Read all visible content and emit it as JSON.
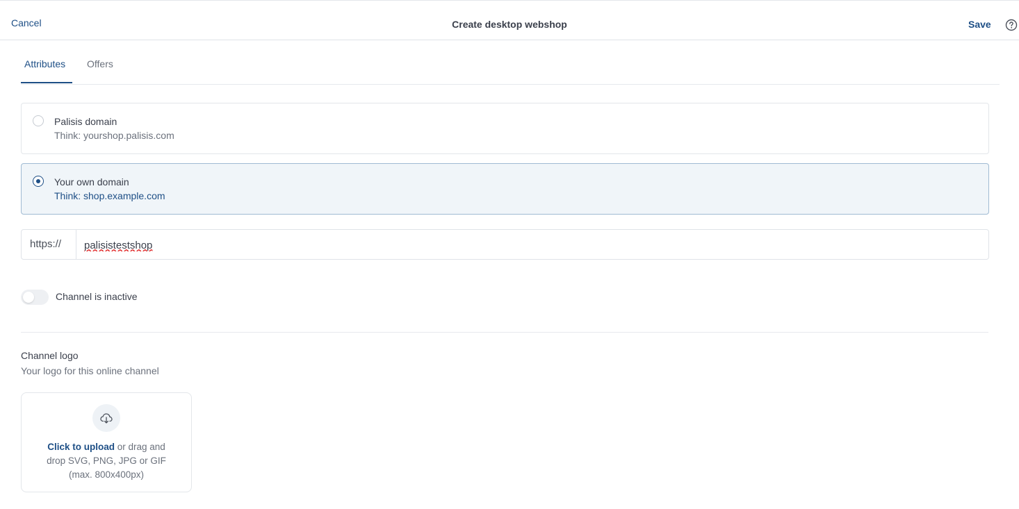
{
  "header": {
    "cancel_label": "Cancel",
    "title": "Create desktop webshop",
    "save_label": "Save",
    "help_icon": "question-circle-icon"
  },
  "tabs": [
    {
      "label": "Attributes",
      "active": true
    },
    {
      "label": "Offers",
      "active": false
    }
  ],
  "domain_options": [
    {
      "title": "Palisis domain",
      "subtitle": "Think: yourshop.palisis.com",
      "selected": false
    },
    {
      "title": "Your own domain",
      "subtitle": "Think: shop.example.com",
      "selected": true
    }
  ],
  "url": {
    "prefix": "https://",
    "value": "palisistestshop"
  },
  "channel_toggle": {
    "label": "Channel is inactive",
    "on": false
  },
  "logo": {
    "title": "Channel logo",
    "subtitle": "Your logo for this online channel",
    "upload_icon": "cloud-download-icon",
    "upload_link": "Click to upload",
    "upload_text_1": " or drag and",
    "upload_text_2": "drop SVG, PNG, JPG or GIF",
    "upload_text_3": "(max. 800x400px)"
  },
  "colors": {
    "accent": "#1e4f86",
    "selected_bg": "#f0f5f9",
    "border": "#e3e6ea"
  }
}
